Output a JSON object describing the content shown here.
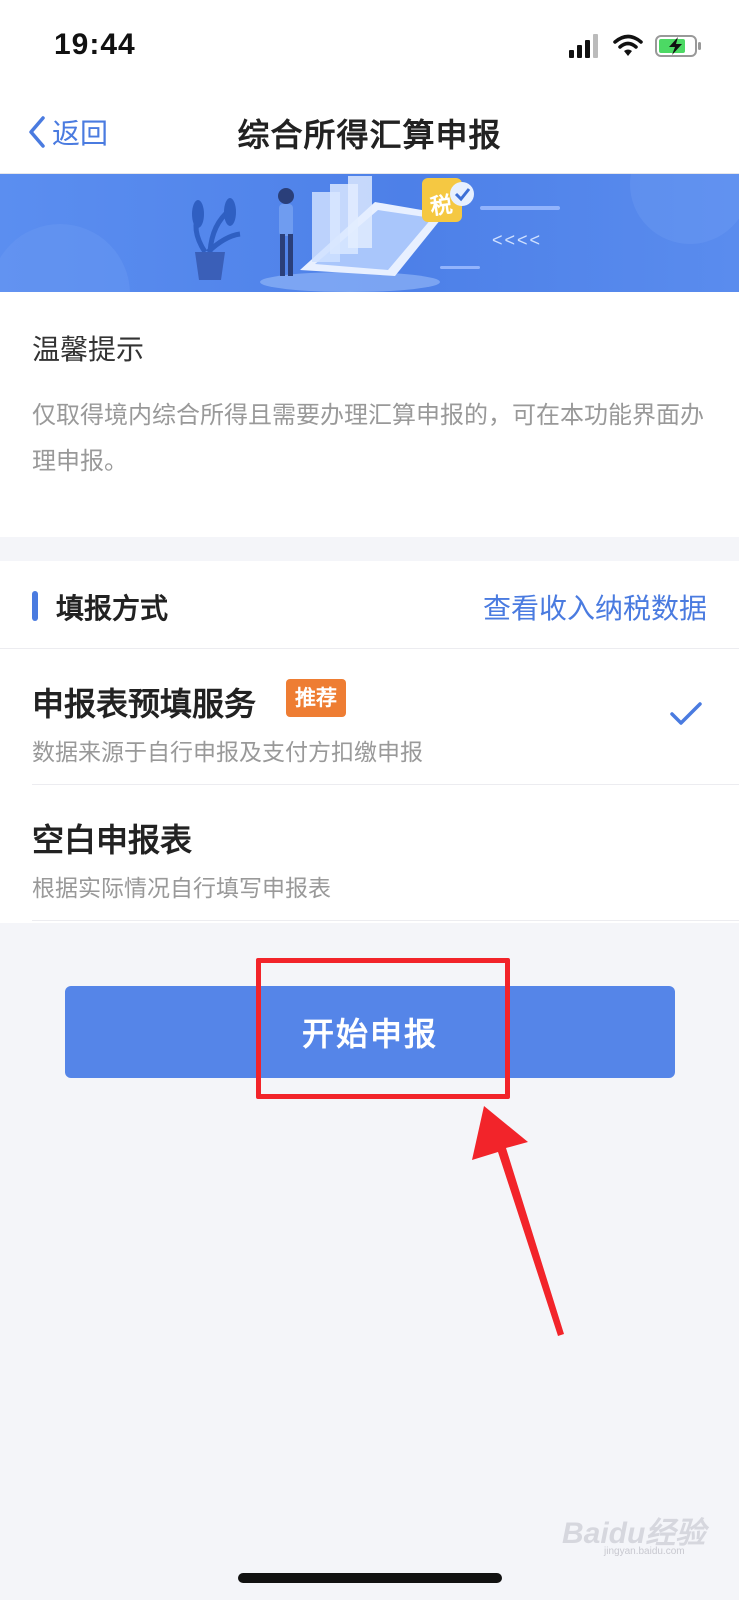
{
  "status_bar": {
    "time": "19:44"
  },
  "nav": {
    "back_label": "返回",
    "title": "综合所得汇算申报"
  },
  "banner": {
    "tax_label": "税",
    "arrows": "<<<<"
  },
  "tips": {
    "title": "温馨提示",
    "text": "仅取得境内综合所得且需要办理汇算申报的，可在本功能界面办理申报。"
  },
  "method": {
    "title": "填报方式",
    "view_data_link": "查看收入纳税数据",
    "options": [
      {
        "title": "申报表预填服务",
        "badge": "推荐",
        "subtitle": "数据来源于自行申报及支付方扣缴申报",
        "selected": true
      },
      {
        "title": "空白申报表",
        "subtitle": "根据实际情况自行填写申报表",
        "selected": false
      }
    ]
  },
  "start_button_label": "开始申报",
  "watermark": {
    "brand": "Baidu经验",
    "url": "jingyan.baidu.com"
  },
  "colors": {
    "accent": "#4a7be0",
    "button": "#5585e8",
    "badge": "#ee7d33",
    "annotation": "#f2242a"
  }
}
